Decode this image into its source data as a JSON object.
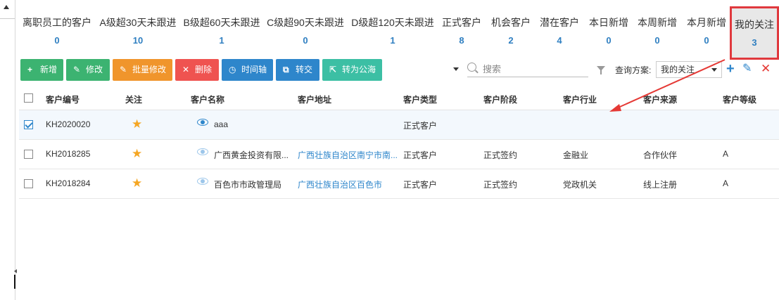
{
  "stats": [
    {
      "label": "离职员工的客户",
      "count": "0"
    },
    {
      "label": "A级超30天未跟进",
      "count": "10"
    },
    {
      "label": "B级超60天未跟进",
      "count": "1"
    },
    {
      "label": "C级超90天未跟进",
      "count": "0"
    },
    {
      "label": "D级超120天未跟进",
      "count": "1"
    },
    {
      "label": "正式客户",
      "count": "8"
    },
    {
      "label": "机会客户",
      "count": "2"
    },
    {
      "label": "潜在客户",
      "count": "4"
    },
    {
      "label": "本日新增",
      "count": "0"
    },
    {
      "label": "本周新增",
      "count": "0"
    },
    {
      "label": "本月新增",
      "count": "0"
    },
    {
      "label": "我的关注",
      "count": "3"
    }
  ],
  "toolbar": {
    "add": "新增",
    "edit": "修改",
    "batch_edit": "批量修改",
    "delete": "删除",
    "timeline": "时间轴",
    "transfer": "转交",
    "to_public": "转为公海",
    "search_placeholder": "搜索",
    "scheme_label": "查询方案:",
    "scheme_value": "我的关注"
  },
  "table": {
    "headers": [
      "客户编号",
      "关注",
      "客户名称",
      "客户地址",
      "客户类型",
      "客户阶段",
      "客户行业",
      "客户来源",
      "客户等级"
    ],
    "rows": [
      {
        "id": "KH2020020",
        "name": "aaa",
        "address": "",
        "type": "正式客户",
        "stage": "",
        "industry": "",
        "source": "",
        "level": ""
      },
      {
        "id": "KH2018285",
        "name": "广西黄金投资有限...",
        "address": "广西壮族自治区南宁市南...",
        "type": "正式客户",
        "stage": "正式签约",
        "industry": "金融业",
        "source": "合作伙伴",
        "level": "A"
      },
      {
        "id": "KH2018284",
        "name": "百色市市政管理局",
        "address": "广西壮族自治区百色市",
        "type": "正式客户",
        "stage": "正式签约",
        "industry": "党政机关",
        "source": "线上注册",
        "level": "A"
      }
    ]
  },
  "colors": {
    "accent": "#2e86cb",
    "highlight": "#e0393e",
    "star": "#f5a623"
  }
}
